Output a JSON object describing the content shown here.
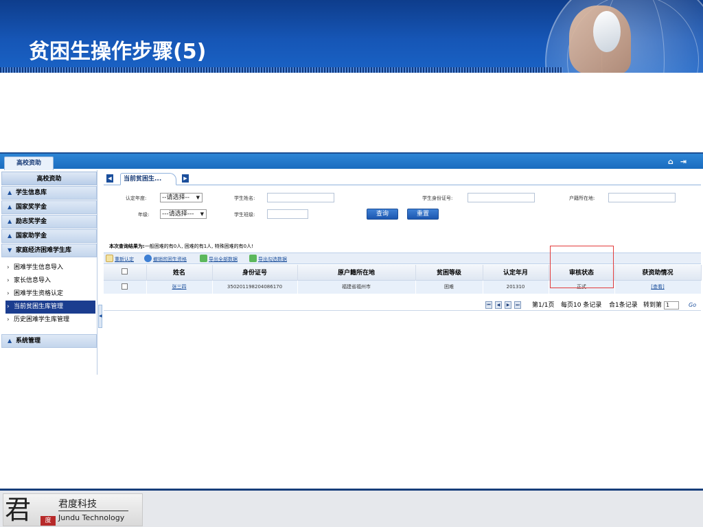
{
  "slide": {
    "title": "贫困生操作步骤(5)"
  },
  "app": {
    "top_tab": "高校资助",
    "top_icons": {
      "home": "home-icon",
      "logout": "logout-icon"
    },
    "sidebar": {
      "title": "高校资助",
      "sections": [
        {
          "label": "学生信息库",
          "arrow": "up"
        },
        {
          "label": "国家奖学金",
          "arrow": "up"
        },
        {
          "label": "励志奖学金",
          "arrow": "up"
        },
        {
          "label": "国家助学金",
          "arrow": "up"
        },
        {
          "label": "家庭经济困难学生库",
          "arrow": "down"
        }
      ],
      "items": [
        {
          "label": "困难学生信息导入"
        },
        {
          "label": "家长信息导入"
        },
        {
          "label": "困难学生资格认定"
        },
        {
          "label": "当前贫困生库管理",
          "active": true
        },
        {
          "label": "历史困难学生库管理"
        }
      ],
      "bottom_section": "系统管理"
    },
    "tab": {
      "label": "当前贫困生..."
    },
    "filters": {
      "year_label": "认定年度:",
      "year_value": "--请选择--",
      "grade_label": "年级:",
      "grade_value": "---请选择---",
      "name_label": "学生姓名:",
      "class_label": "学生班级:",
      "id_label": "学生身份证号:",
      "hukou_label": "户籍所在地:",
      "query_button": "查询",
      "reset_button": "重置"
    },
    "summary": {
      "prefix": "本次查询结果为:",
      "text": "一般困难的有0人,  困难的有1人,  特殊困难的有0人!"
    },
    "actions": [
      {
        "label": "重新认定",
        "icon": "edit-icon"
      },
      {
        "label": "撤销贫困生资格",
        "icon": "info-icon"
      },
      {
        "label": "导出全部数据",
        "icon": "export-icon"
      },
      {
        "label": "导出勾选数据",
        "icon": "export-icon"
      }
    ],
    "table": {
      "headers": [
        "姓名",
        "身份证号",
        "原户籍所在地",
        "贫困等级",
        "认定年月",
        "审核状态",
        "获资助情况"
      ],
      "rows": [
        {
          "name": "张三四",
          "id_number": "350201198204086170",
          "hukou": "福建省福州市",
          "level": "困难",
          "date": "201310",
          "status": "正式",
          "aid": "[查看]"
        }
      ]
    },
    "pager": {
      "page_info": "第1/1页",
      "per_page": "每页10 条记录",
      "total": "合1条记录",
      "goto_label": "转到第",
      "goto_value": "1",
      "go": "Go"
    }
  },
  "footer": {
    "logo_glyph": "君",
    "logo_seal": "度",
    "company_cn": "君度科技",
    "company_en": "Jundu Technology"
  }
}
